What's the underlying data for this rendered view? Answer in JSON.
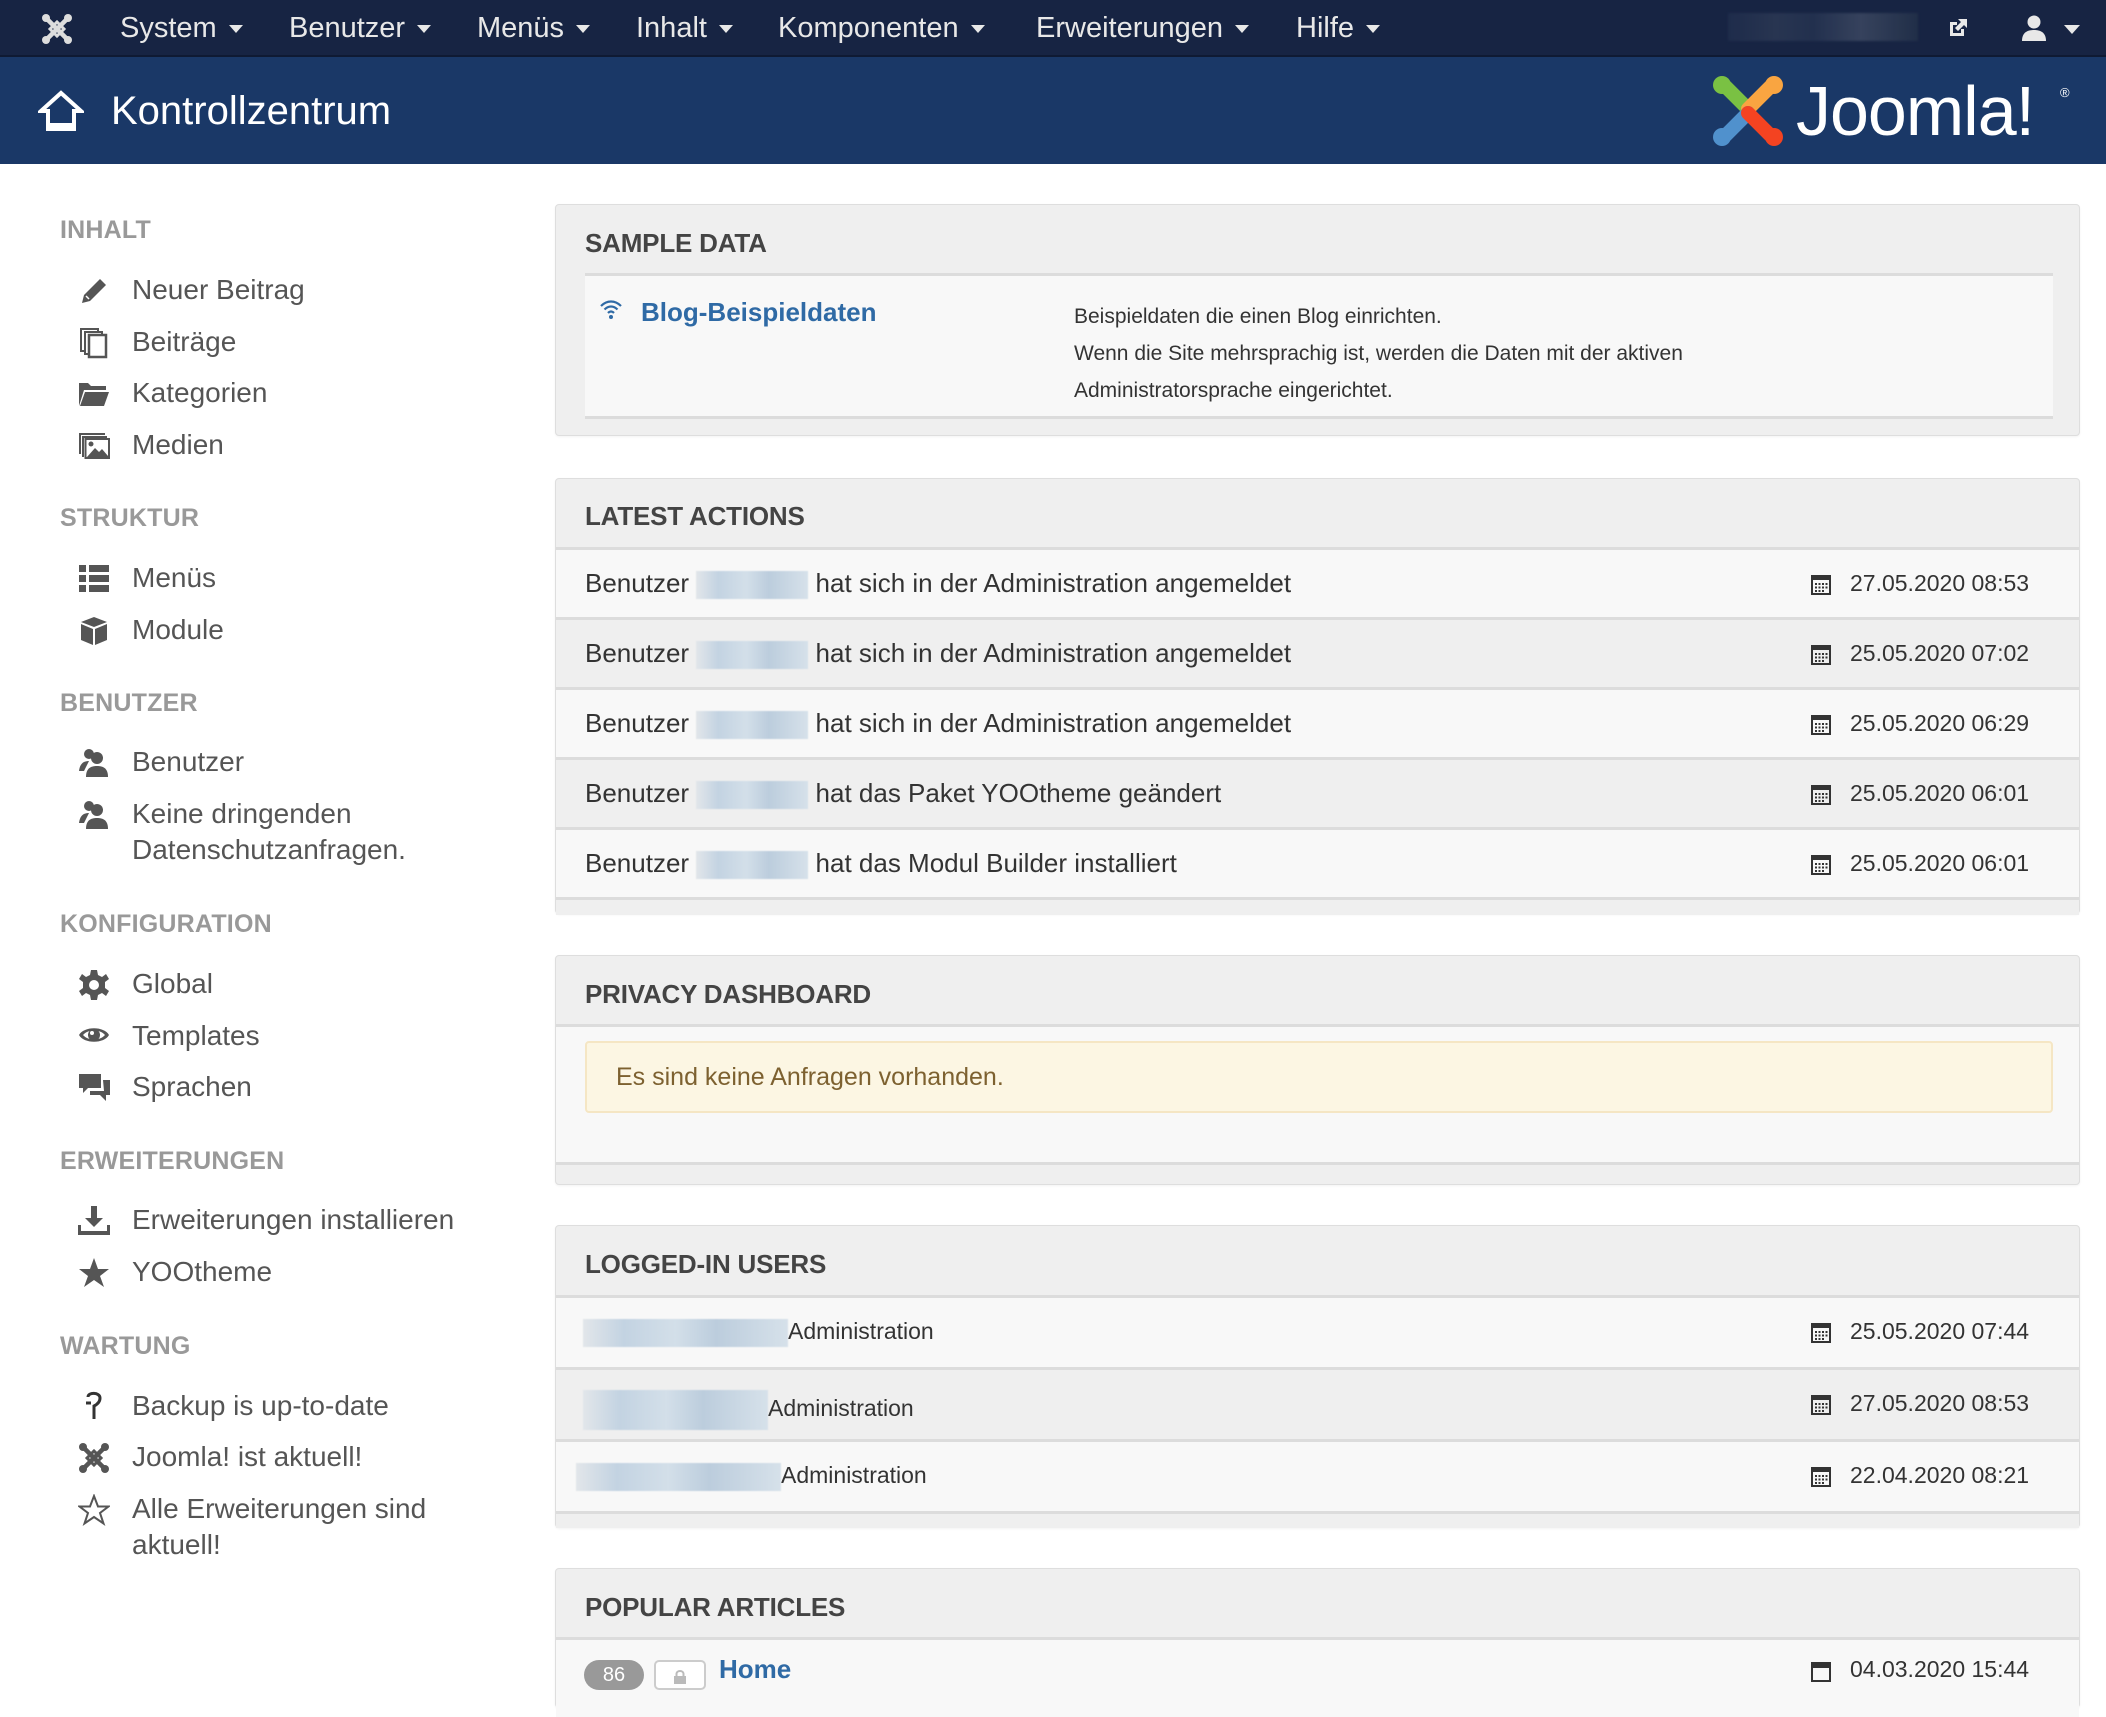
{
  "topnav": {
    "menus": [
      {
        "label": "System"
      },
      {
        "label": "Benutzer"
      },
      {
        "label": "Menüs"
      },
      {
        "label": "Inhalt"
      },
      {
        "label": "Komponenten"
      },
      {
        "label": "Erweiterungen"
      },
      {
        "label": "Hilfe"
      }
    ]
  },
  "titlebar": {
    "title": "Kontrollzentrum",
    "logo_text": "Joomla!",
    "logo_reg": "®"
  },
  "sidebar": {
    "sections": [
      {
        "heading": "INHALT",
        "items": [
          {
            "label": "Neuer Beitrag",
            "icon": "pencil-icon"
          },
          {
            "label": "Beiträge",
            "icon": "copy-icon"
          },
          {
            "label": "Kategorien",
            "icon": "folder-open-icon"
          },
          {
            "label": "Medien",
            "icon": "images-icon"
          }
        ]
      },
      {
        "heading": "STRUKTUR",
        "items": [
          {
            "label": "Menüs",
            "icon": "list-icon"
          },
          {
            "label": "Module",
            "icon": "cube-icon"
          }
        ]
      },
      {
        "heading": "BENUTZER",
        "items": [
          {
            "label": "Benutzer",
            "icon": "users-icon"
          },
          {
            "label": "Keine dringenden Datenschutzanfragen.",
            "icon": "users-icon"
          }
        ]
      },
      {
        "heading": "KONFIGURATION",
        "items": [
          {
            "label": "Global",
            "icon": "cog-icon"
          },
          {
            "label": "Templates",
            "icon": "eye-icon"
          },
          {
            "label": "Sprachen",
            "icon": "comments-icon"
          }
        ]
      },
      {
        "heading": "ERWEITERUNGEN",
        "items": [
          {
            "label": "Erweiterungen installieren",
            "icon": "download-icon"
          },
          {
            "label": "YOOtheme",
            "icon": "star-icon"
          }
        ]
      },
      {
        "heading": "WARTUNG",
        "items": [
          {
            "label": "Backup is up-to-date",
            "icon": "akeeba-icon"
          },
          {
            "label": "Joomla! ist aktuell!",
            "icon": "joomla-icon"
          },
          {
            "label": "Alle Erweiterungen sind aktuell!",
            "icon": "star-empty-icon"
          }
        ]
      }
    ]
  },
  "panels": {
    "sample_data": {
      "title": "SAMPLE DATA",
      "link": "Blog-Beispieldaten",
      "desc": [
        "Beispieldaten die einen Blog einrichten.",
        "Wenn die Site mehrsprachig ist, werden die Daten mit der aktiven",
        "Administratorsprache eingerichtet."
      ]
    },
    "latest_actions": {
      "title": "LATEST ACTIONS",
      "rows": [
        {
          "prefix": "Benutzer",
          "action": "hat sich in der Administration angemeldet",
          "date": "27.05.2020 08:53"
        },
        {
          "prefix": "Benutzer",
          "action": "hat sich in der Administration angemeldet",
          "date": "25.05.2020 07:02"
        },
        {
          "prefix": "Benutzer",
          "action": "hat sich in der Administration angemeldet",
          "date": "25.05.2020 06:29"
        },
        {
          "prefix": "Benutzer",
          "action": "hat das Paket YOOtheme geändert",
          "date": "25.05.2020 06:01"
        },
        {
          "prefix": "Benutzer",
          "action": "hat das Modul Builder installiert",
          "date": "25.05.2020 06:01"
        }
      ]
    },
    "privacy": {
      "title": "PRIVACY DASHBOARD",
      "message": "Es sind keine Anfragen vorhanden."
    },
    "logged_in": {
      "title": "LOGGED-IN USERS",
      "rows": [
        {
          "location": "Administration",
          "date": "25.05.2020 07:44"
        },
        {
          "location": "Administration",
          "date": "27.05.2020 08:53"
        },
        {
          "location": "Administration",
          "date": "22.04.2020 08:21"
        }
      ]
    },
    "popular": {
      "title": "POPULAR ARTICLES",
      "rows": [
        {
          "hits": "86",
          "title": "Home",
          "date": "04.03.2020 15:44"
        }
      ]
    }
  },
  "colors": {
    "topnav_bg": "#172443",
    "titlebar_bg": "#1a3867",
    "link": "#2f6aa5",
    "alert_bg": "#fcf6e3",
    "alert_text": "#7d6130"
  }
}
